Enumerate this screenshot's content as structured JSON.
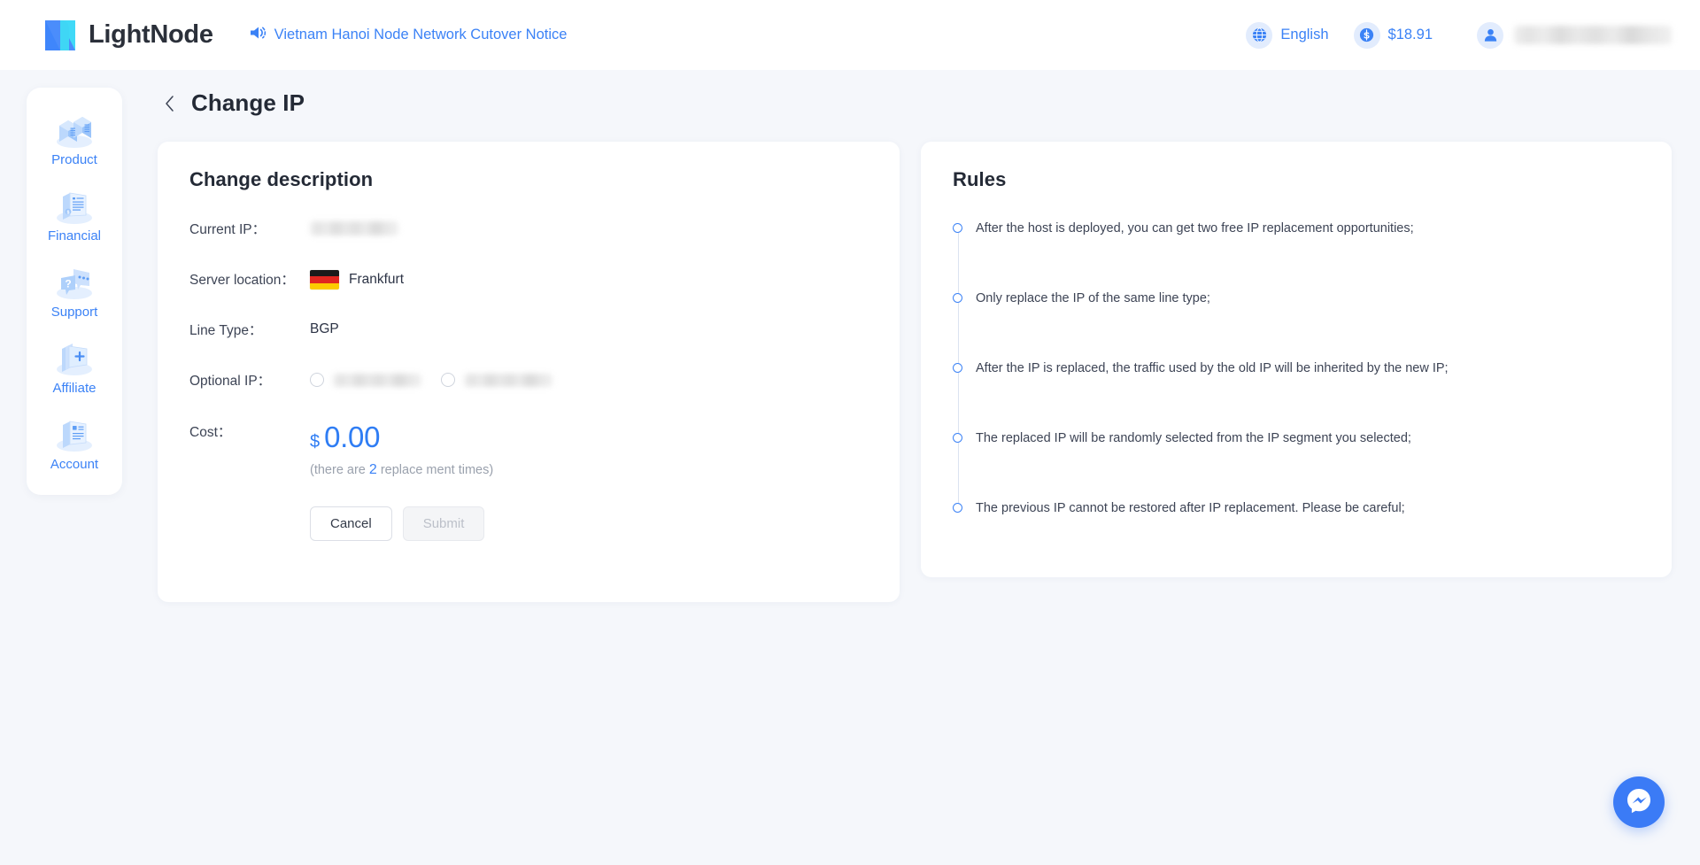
{
  "header": {
    "logo_text": "LightNode",
    "logo_icon": "lightnode-logo-icon",
    "announcement_icon": "speaker-announcement-icon",
    "announcement_text": "Vietnam Hanoi Node Network Cutover Notice",
    "language_icon": "globe-icon",
    "language_label": "English",
    "balance_icon": "dollar-circle-icon",
    "balance_label": "$18.91",
    "user_icon": "user-avatar-icon",
    "user_name": ""
  },
  "sidebar": {
    "items": [
      {
        "label": "Product",
        "icon": "server-racks-icon"
      },
      {
        "label": "Financial",
        "icon": "invoice-billing-icon"
      },
      {
        "label": "Support",
        "icon": "question-chat-icon"
      },
      {
        "label": "Affiliate",
        "icon": "folder-plus-icon"
      },
      {
        "label": "Account",
        "icon": "account-document-icon"
      }
    ]
  },
  "page": {
    "back_icon": "chevron-left-icon",
    "title": "Change IP"
  },
  "change_description": {
    "title": "Change description",
    "labels": {
      "current_ip": "Current IP：",
      "server_location": "Server location：",
      "line_type": "Line Type：",
      "optional_ip": "Optional IP：",
      "cost": "Cost："
    },
    "current_ip_value": "",
    "server_location_flag": "germany-flag-icon",
    "server_location_value": "Frankfurt",
    "line_type_value": "BGP",
    "optional_ips": [
      {
        "value": "",
        "selected": false
      },
      {
        "value": "",
        "selected": false
      }
    ],
    "cost_currency": "$",
    "cost_amount": "0.00",
    "cost_note_prefix": "(there are ",
    "cost_note_count": "2",
    "cost_note_suffix": " replace ment times)",
    "cancel_label": "Cancel",
    "submit_label": "Submit",
    "submit_disabled": true
  },
  "rules": {
    "title": "Rules",
    "items": [
      "After the host is deployed, you can get two free IP replacement opportunities;",
      "Only replace the IP of the same line type;",
      "After the IP is replaced, the traffic used by the old IP will be inherited by the new IP;",
      "The replaced IP will be randomly selected from the IP segment you selected;",
      "The previous IP cannot be restored after IP replacement. Please be careful;"
    ]
  },
  "fab": {
    "icon": "messenger-icon"
  },
  "colors": {
    "accent": "#3b82f6",
    "page_background": "#f5f7fb",
    "card_background": "#ffffff",
    "cost_blue": "#2f7df4",
    "fab_blue": "#3b7bf6"
  }
}
